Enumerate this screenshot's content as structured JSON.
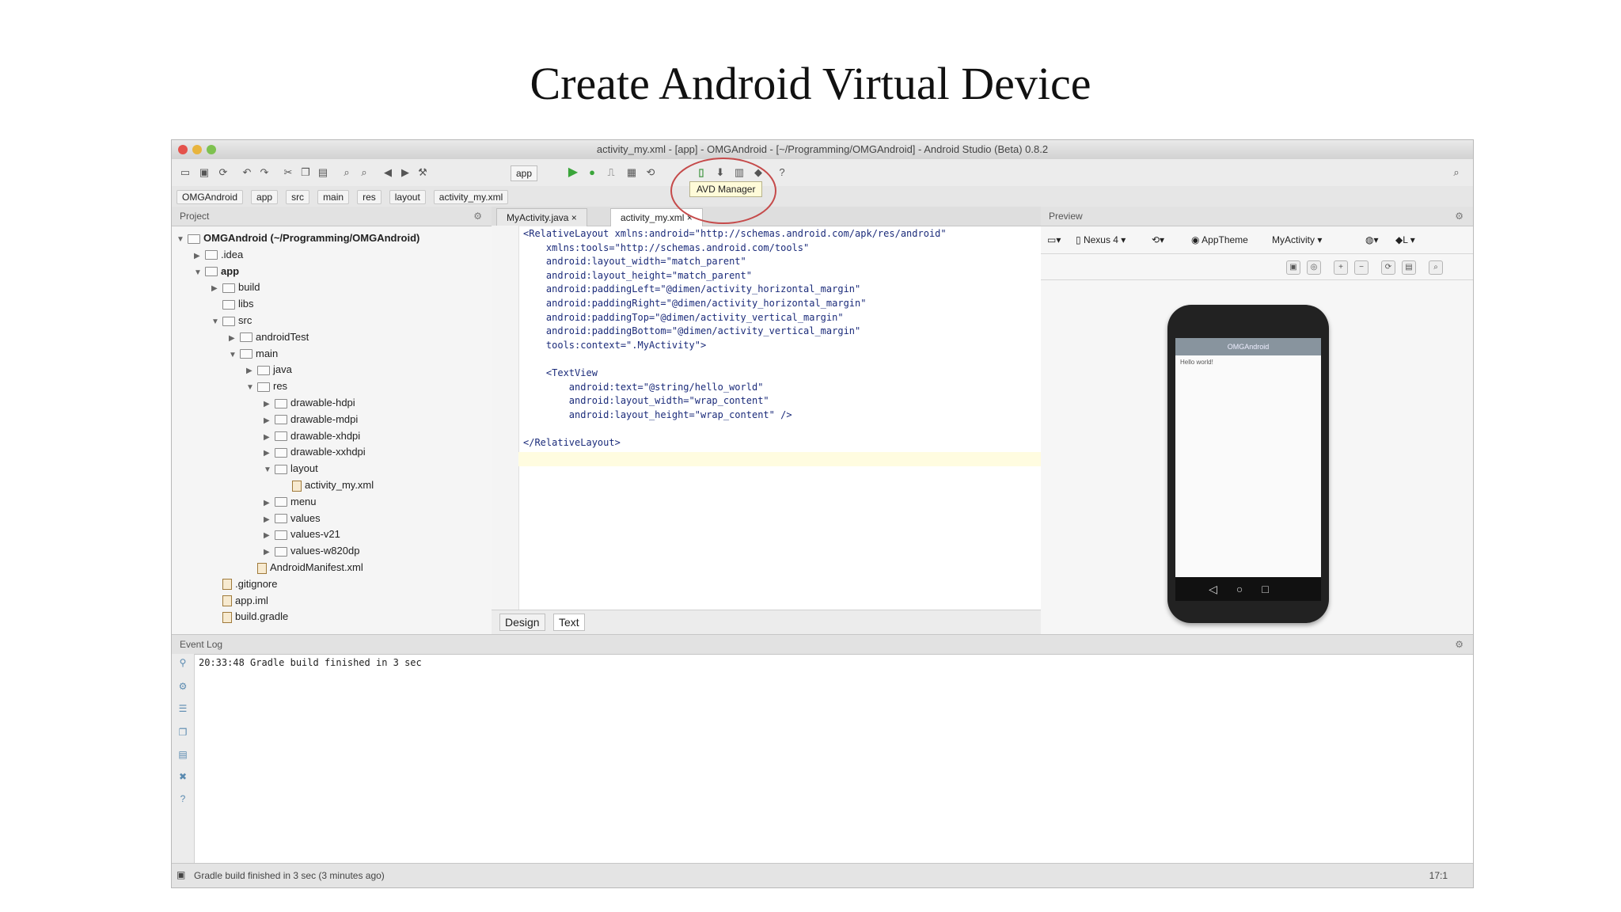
{
  "slide": {
    "title": "Create Android Virtual Device"
  },
  "window": {
    "title": "activity_my.xml - [app] - OMGAndroid - [~/Programming/OMGAndroid] - Android Studio (Beta) 0.8.2"
  },
  "toolbar": {
    "app_combo": "app",
    "tooltip": "AVD Manager"
  },
  "breadcrumb": [
    "OMGAndroid",
    "app",
    "src",
    "main",
    "res",
    "layout",
    "activity_my.xml"
  ],
  "project": {
    "header": "Project",
    "tree": [
      {
        "label": "OMGAndroid (~/Programming/OMGAndroid)",
        "depth": 0,
        "type": "folder",
        "open": true
      },
      {
        "label": ".idea",
        "depth": 1,
        "type": "folder",
        "open": false
      },
      {
        "label": "app",
        "depth": 1,
        "type": "folder",
        "open": true
      },
      {
        "label": "build",
        "depth": 2,
        "type": "folder",
        "open": false
      },
      {
        "label": "libs",
        "depth": 2,
        "type": "folder",
        "open": null
      },
      {
        "label": "src",
        "depth": 2,
        "type": "folder",
        "open": true
      },
      {
        "label": "androidTest",
        "depth": 3,
        "type": "folder",
        "open": false
      },
      {
        "label": "main",
        "depth": 3,
        "type": "folder",
        "open": true
      },
      {
        "label": "java",
        "depth": 4,
        "type": "folder",
        "open": false
      },
      {
        "label": "res",
        "depth": 4,
        "type": "folder",
        "open": true
      },
      {
        "label": "drawable-hdpi",
        "depth": 5,
        "type": "folder",
        "open": false
      },
      {
        "label": "drawable-mdpi",
        "depth": 5,
        "type": "folder",
        "open": false
      },
      {
        "label": "drawable-xhdpi",
        "depth": 5,
        "type": "folder",
        "open": false
      },
      {
        "label": "drawable-xxhdpi",
        "depth": 5,
        "type": "folder",
        "open": false
      },
      {
        "label": "layout",
        "depth": 5,
        "type": "folder",
        "open": true
      },
      {
        "label": "activity_my.xml",
        "depth": 6,
        "type": "file",
        "open": null
      },
      {
        "label": "menu",
        "depth": 5,
        "type": "folder",
        "open": false
      },
      {
        "label": "values",
        "depth": 5,
        "type": "folder",
        "open": false
      },
      {
        "label": "values-v21",
        "depth": 5,
        "type": "folder",
        "open": false
      },
      {
        "label": "values-w820dp",
        "depth": 5,
        "type": "folder",
        "open": false
      },
      {
        "label": "AndroidManifest.xml",
        "depth": 4,
        "type": "file",
        "open": null
      },
      {
        "label": ".gitignore",
        "depth": 2,
        "type": "file",
        "open": null
      },
      {
        "label": "app.iml",
        "depth": 2,
        "type": "file",
        "open": null
      },
      {
        "label": "build.gradle",
        "depth": 2,
        "type": "file",
        "open": null
      }
    ]
  },
  "editor": {
    "tabs": [
      "MyActivity.java ×",
      "activity_my.xml ×"
    ],
    "code": [
      "<RelativeLayout xmlns:android=\"http://schemas.android.com/apk/res/android\"",
      "    xmlns:tools=\"http://schemas.android.com/tools\"",
      "    android:layout_width=\"match_parent\"",
      "    android:layout_height=\"match_parent\"",
      "    android:paddingLeft=\"@dimen/activity_horizontal_margin\"",
      "    android:paddingRight=\"@dimen/activity_horizontal_margin\"",
      "    android:paddingTop=\"@dimen/activity_vertical_margin\"",
      "    android:paddingBottom=\"@dimen/activity_vertical_margin\"",
      "    tools:context=\".MyActivity\">",
      "",
      "    <TextView",
      "        android:text=\"@string/hello_world\"",
      "        android:layout_width=\"wrap_content\"",
      "        android:layout_height=\"wrap_content\" />",
      "",
      "</RelativeLayout>"
    ],
    "bottom_tabs": [
      "Design",
      "Text"
    ]
  },
  "preview": {
    "header": "Preview",
    "device": "Nexus 4",
    "theme": "AppTheme",
    "activity": "MyActivity",
    "api": "L",
    "app_bar_title": "OMGAndroid",
    "hello_text": "Hello world!",
    "nav_glyphs": "◁○□"
  },
  "event_log": {
    "header": "Event Log",
    "lines": [
      "20:33:48 Gradle build finished in 3 sec"
    ]
  },
  "status": {
    "text": "Gradle build finished in 3 sec (3 minutes ago)",
    "position": "17:1"
  }
}
